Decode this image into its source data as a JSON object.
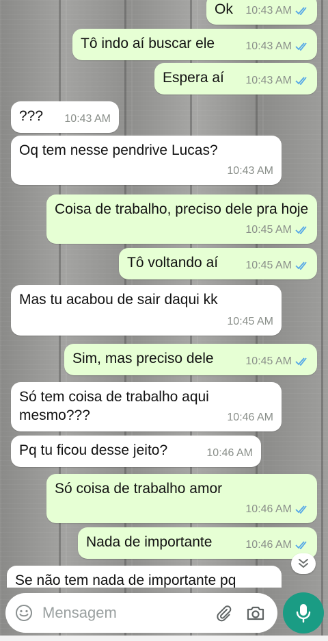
{
  "colors": {
    "outgoing_bubble": "#e6ffd4",
    "incoming_bubble": "#ffffff",
    "read_ticks": "#53a6e8",
    "mic_button": "#1a9c84"
  },
  "messages": [
    {
      "direction": "out",
      "text": "Ok",
      "time": "10:43 AM",
      "status": "read"
    },
    {
      "direction": "out",
      "text": "Tô indo aí buscar ele",
      "time": "10:43 AM",
      "status": "read"
    },
    {
      "direction": "out",
      "text": "Espera aí",
      "time": "10:43 AM",
      "status": "read"
    },
    {
      "direction": "in",
      "text": "???",
      "time": "10:43 AM"
    },
    {
      "direction": "in",
      "text": "Oq tem nesse pendrive Lucas?",
      "time": "10:43 AM"
    },
    {
      "direction": "out",
      "text": "Coisa de trabalho, preciso dele pra hoje",
      "time": "10:45 AM",
      "status": "read"
    },
    {
      "direction": "out",
      "text": "Tô voltando aí",
      "time": "10:45 AM",
      "status": "read"
    },
    {
      "direction": "in",
      "text": "Mas tu acabou de sair daqui kk",
      "time": "10:45 AM"
    },
    {
      "direction": "out",
      "text": "Sim, mas preciso dele",
      "time": "10:45 AM",
      "status": "read"
    },
    {
      "direction": "in",
      "text": "Só tem coisa de trabalho aqui mesmo???",
      "time": "10:46 AM"
    },
    {
      "direction": "in",
      "text": "Pq tu ficou desse jeito?",
      "time": "10:46 AM"
    },
    {
      "direction": "out",
      "text": "Só coisa de trabalho amor",
      "time": "10:46 AM",
      "status": "read"
    },
    {
      "direction": "out",
      "text": "Nada de importante",
      "time": "10:46 AM",
      "status": "read"
    },
    {
      "direction": "in",
      "text": "Se não tem nada de importante pq",
      "time": ""
    }
  ],
  "composer": {
    "placeholder": "Mensagem",
    "icons": [
      "emoji-icon",
      "attach-icon",
      "camera-icon",
      "mic-icon"
    ]
  },
  "scroll_button": {
    "icon": "double-chevron-down-icon"
  }
}
